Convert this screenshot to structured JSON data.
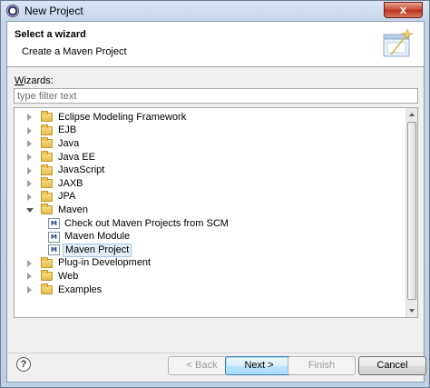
{
  "window": {
    "title": "New Project",
    "close_glyph": "x"
  },
  "header": {
    "title": "Select a wizard",
    "description": "Create a Maven Project",
    "image_icon": "wizard-banner-icon"
  },
  "wizards": {
    "label_prefix": "",
    "label_mnemonic": "W",
    "label_rest": "izards:",
    "filter_placeholder": "type filter text",
    "filter_value": ""
  },
  "tree": {
    "items": [
      {
        "label": "Eclipse Modeling Framework",
        "type": "folder",
        "expanded": false,
        "level": 0
      },
      {
        "label": "EJB",
        "type": "folder",
        "expanded": false,
        "level": 0
      },
      {
        "label": "Java",
        "type": "folder",
        "expanded": false,
        "level": 0
      },
      {
        "label": "Java EE",
        "type": "folder",
        "expanded": false,
        "level": 0
      },
      {
        "label": "JavaScript",
        "type": "folder",
        "expanded": false,
        "level": 0
      },
      {
        "label": "JAXB",
        "type": "folder",
        "expanded": false,
        "level": 0
      },
      {
        "label": "JPA",
        "type": "folder",
        "expanded": false,
        "level": 0
      },
      {
        "label": "Maven",
        "type": "folder",
        "expanded": true,
        "level": 0
      },
      {
        "label": "Check out Maven Projects from SCM",
        "type": "wizard",
        "level": 1
      },
      {
        "label": "Maven Module",
        "type": "wizard",
        "level": 1
      },
      {
        "label": "Maven Project",
        "type": "wizard",
        "level": 1,
        "selected": true
      },
      {
        "label": "Plug-in Development",
        "type": "folder",
        "expanded": false,
        "level": 0
      },
      {
        "label": "Web",
        "type": "folder",
        "expanded": false,
        "level": 0
      },
      {
        "label": "Examples",
        "type": "folder",
        "expanded": false,
        "level": 0
      }
    ]
  },
  "footer": {
    "help_glyph": "?",
    "back_label": "< Back",
    "next_label": "Next >",
    "finish_label": "Finish",
    "cancel_label": "Cancel"
  },
  "colors": {
    "selection_bg": "#e6eef9",
    "default_button": "#bee6fd",
    "close_button": "#c9472f"
  }
}
